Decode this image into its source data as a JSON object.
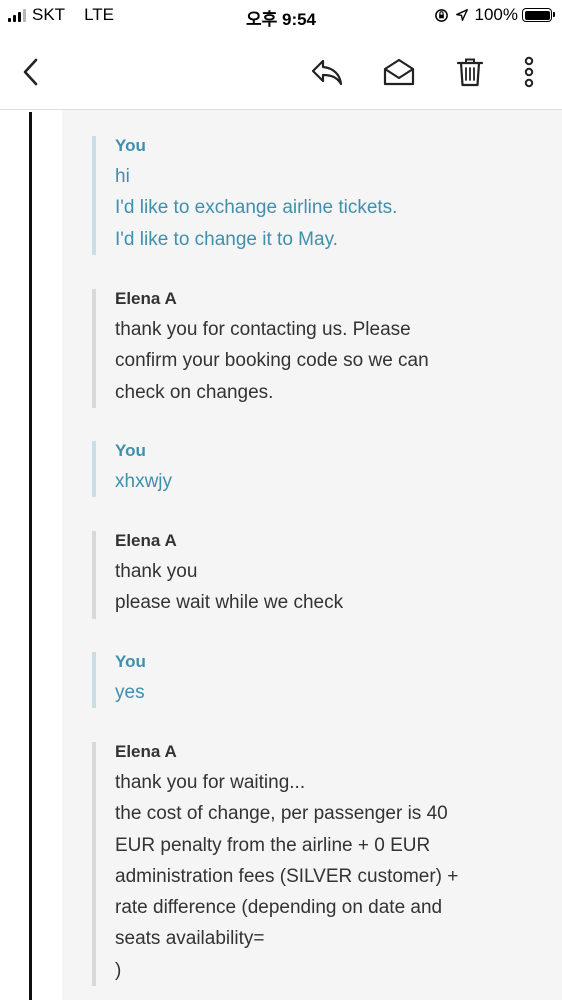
{
  "status_bar": {
    "carrier": "SKT",
    "network": "LTE",
    "time": "오후 9:54",
    "battery": "100%",
    "signal_bars_active": 3,
    "signal_bars_total": 4
  },
  "toolbar": {
    "back_icon": "chevron-left-icon",
    "reply_icon": "reply-icon",
    "mark_unread_icon": "envelope-open-icon",
    "delete_icon": "trash-icon",
    "more_icon": "more-vertical-icon"
  },
  "colors": {
    "you_text": "#3f8fad",
    "agent_text": "#333333",
    "background_quote": "#f5f5f5"
  },
  "messages": [
    {
      "sender": "You",
      "lines": [
        "hi",
        "I'd like to exchange airline tickets.",
        "I'd like to change it to May."
      ]
    },
    {
      "sender": "Elena A",
      "lines": [
        "thank you for contacting us. Please",
        "confirm your booking code so we can",
        "check on changes."
      ]
    },
    {
      "sender": "You",
      "lines": [
        "xhxwjy"
      ]
    },
    {
      "sender": "Elena A",
      "lines": [
        "thank you",
        "please wait while we check"
      ]
    },
    {
      "sender": "You",
      "lines": [
        "yes"
      ]
    },
    {
      "sender": "Elena A",
      "lines": [
        "thank you for waiting...",
        "the cost of change, per passenger is 40",
        "EUR penalty from the airline + 0 EUR",
        "administration fees (SILVER customer) +",
        "rate difference (depending on date and",
        "seats availability=",
        ")"
      ]
    }
  ]
}
